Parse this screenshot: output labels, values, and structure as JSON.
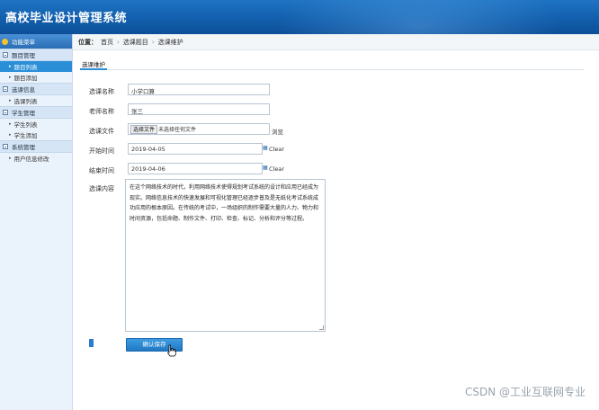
{
  "app": {
    "title": "高校毕业设计管理系统"
  },
  "sidebar": {
    "header": "功能菜单",
    "groups": [
      {
        "title": "题目管理",
        "items": [
          {
            "label": "题目列表",
            "active": true
          },
          {
            "label": "题目添加"
          }
        ]
      },
      {
        "title": "选课信息",
        "items": [
          {
            "label": "选课列表"
          }
        ]
      },
      {
        "title": "学生管理",
        "items": [
          {
            "label": "学生列表"
          },
          {
            "label": "学生添加"
          }
        ]
      },
      {
        "title": "系统管理",
        "items": [
          {
            "label": "用户信息修改"
          }
        ]
      }
    ]
  },
  "breadcrumb": {
    "label": "位置：",
    "items": [
      "首页",
      "选课题目",
      "选课维护"
    ]
  },
  "tab": {
    "label": "选课维护"
  },
  "form": {
    "course_name": {
      "label": "选课名称",
      "value": "小学口算"
    },
    "teacher": {
      "label": "老师名称",
      "value": "张三"
    },
    "file": {
      "label": "选课文件",
      "button": "选择文件",
      "status": "未选择任何文件",
      "browse": "浏览"
    },
    "start": {
      "label": "开始时间",
      "value": "2019-04-05",
      "clear": "Clear"
    },
    "end": {
      "label": "结束时间",
      "value": "2019-04-06",
      "clear": "Clear"
    },
    "content": {
      "label": "选课内容",
      "value": "在这个网络技术的时代，利用网络技术使得规划考试系统的设计和应用已经成为现实。网络信息技术的快速发展和可视化管理已经逐步普及是无纸化考试系统成功应用的根本原因。在传统的考试中，一场组织的制作需要大量的人力、物力和时间资源，包括命题、制作文件、打印、检查、标记、分析和评分等过程。"
    },
    "save_button": "确认保存"
  },
  "watermark": "CSDN @工业互联网专业"
}
